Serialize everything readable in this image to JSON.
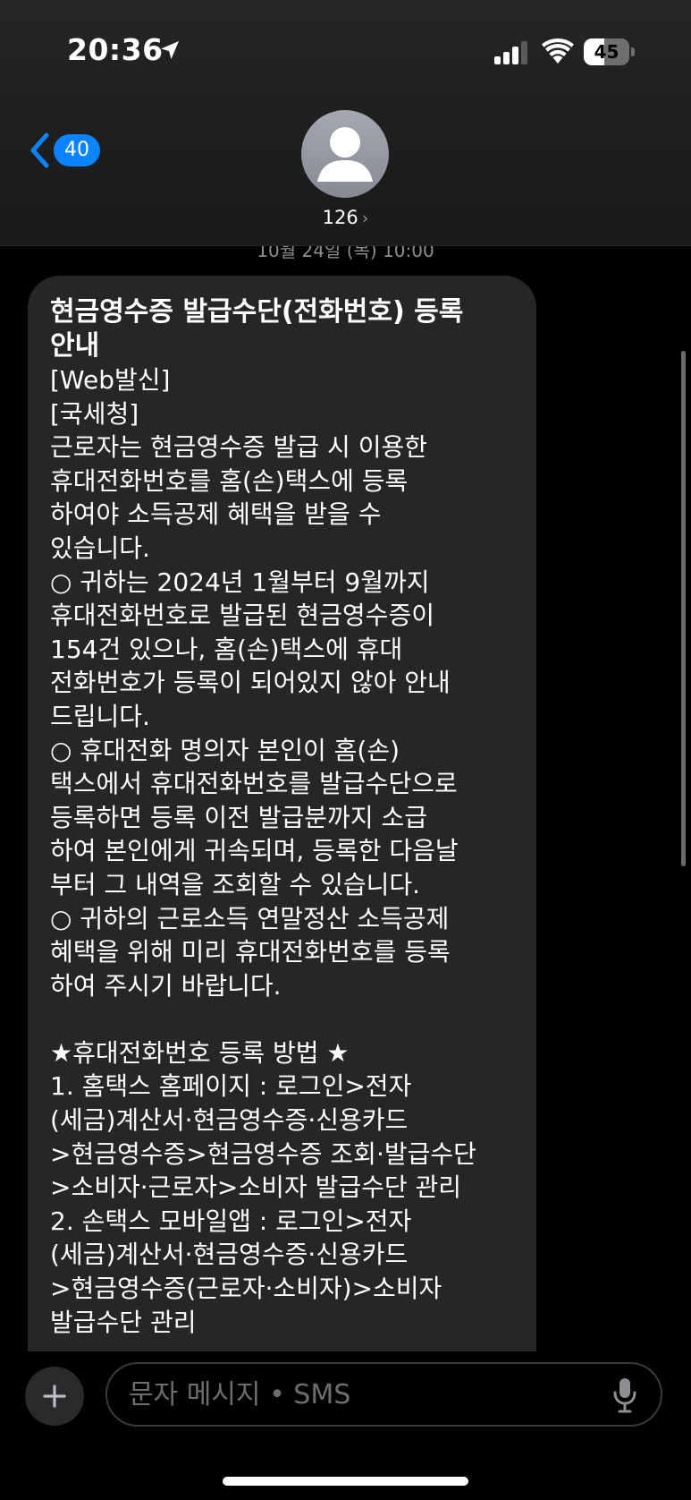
{
  "status_bar": {
    "time": "20:36",
    "battery_level": 45,
    "battery_text": "45",
    "icons": [
      "location-arrow-icon",
      "cellular-signal-icon",
      "wifi-icon",
      "battery-icon"
    ]
  },
  "header": {
    "back_badge": "40",
    "contact_name": "126",
    "contact_chevron": "›",
    "avatar_icon": "person-silhouette-icon"
  },
  "date_divider": "10월 24일 (목) 10:00",
  "message": {
    "title_lines": [
      "현금영수증 발급수단(전화번호) 등록",
      "안내"
    ],
    "body_lines": [
      "[Web발신]",
      "[국세청]",
      "근로자는 현금영수증 발급 시 이용한",
      "휴대전화번호를 홈(손)택스에 등록",
      "하여야 소득공제 혜택을 받을 수",
      "있습니다.",
      "○ 귀하는 2024년 1월부터 9월까지",
      "휴대전화번호로 발급된 현금영수증이",
      "154건 있으나, 홈(손)택스에 휴대",
      "전화번호가 등록이 되어있지 않아 안내",
      "드립니다.",
      "○ 휴대전화 명의자 본인이 홈(손)",
      "택스에서 휴대전화번호를 발급수단으로",
      "등록하면 등록 이전 발급분까지 소급",
      "하여 본인에게 귀속되며, 등록한 다음날",
      "부터 그 내역을 조회할 수 있습니다.",
      "○ 귀하의 근로소득 연말정산 소득공제",
      "혜택을 위해 미리 휴대전화번호를 등록",
      "하여 주시기 바랍니다.",
      "",
      "★휴대전화번호 등록 방법 ★",
      "1. 홈택스 홈페이지 : 로그인>전자",
      "(세금)계산서·현금영수증·신용카드",
      ">현금영수증>현금영수증 조회·발급수단",
      ">소비자·근로자>소비자 발급수단 관리",
      "2. 손택스 모바일앱 : 로그인>전자",
      "(세금)계산서·현금영수증·신용카드",
      ">현금영수증(근로자·소비자)>소비자",
      "발급수단 관리"
    ]
  },
  "input": {
    "placeholder": "문자 메시지 • SMS",
    "value": ""
  },
  "colors": {
    "accent": "#0a84ff",
    "bubble": "#262629",
    "background": "#000000",
    "muted_text": "#8e8e93"
  }
}
